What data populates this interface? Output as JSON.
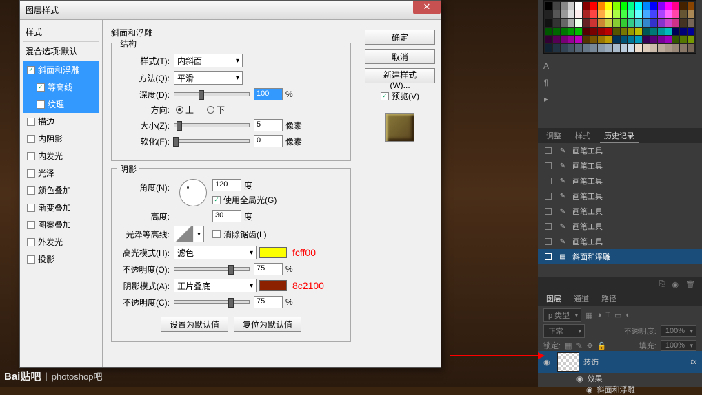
{
  "dialog": {
    "title": "图层样式",
    "styles_header": "样式",
    "blend_options": "混合选项:默认",
    "items": [
      {
        "label": "斜面和浮雕",
        "checked": true,
        "selected": true
      },
      {
        "label": "等高线",
        "checked": true,
        "sub": true,
        "selected": true
      },
      {
        "label": "纹理",
        "checked": false,
        "sub": true,
        "selected": true
      },
      {
        "label": "描边",
        "checked": false
      },
      {
        "label": "内阴影",
        "checked": false
      },
      {
        "label": "内发光",
        "checked": false
      },
      {
        "label": "光泽",
        "checked": false
      },
      {
        "label": "颜色叠加",
        "checked": false
      },
      {
        "label": "渐变叠加",
        "checked": false
      },
      {
        "label": "图案叠加",
        "checked": false
      },
      {
        "label": "外发光",
        "checked": false
      },
      {
        "label": "投影",
        "checked": false
      }
    ],
    "section_title": "斜面和浮雕",
    "structure": {
      "legend": "结构",
      "style_lbl": "样式(T):",
      "style_val": "内斜面",
      "technique_lbl": "方法(Q):",
      "technique_val": "平滑",
      "depth_lbl": "深度(D):",
      "depth_val": "100",
      "depth_unit": "%",
      "direction_lbl": "方向:",
      "up": "上",
      "down": "下",
      "size_lbl": "大小(Z):",
      "size_val": "5",
      "size_unit": "像素",
      "soften_lbl": "软化(F):",
      "soften_val": "0",
      "soften_unit": "像素"
    },
    "shadow": {
      "legend": "阴影",
      "angle_lbl": "角度(N):",
      "angle_val": "120",
      "angle_unit": "度",
      "global_light": "使用全局光(G)",
      "altitude_lbl": "高度:",
      "altitude_val": "30",
      "altitude_unit": "度",
      "gloss_contour_lbl": "光泽等高线:",
      "antialias": "消除锯齿(L)",
      "highlight_mode_lbl": "高光模式(H):",
      "highlight_mode_val": "滤色",
      "highlight_color": "#fcff00",
      "highlight_hex": "fcff00",
      "highlight_opacity_lbl": "不透明度(O):",
      "highlight_opacity_val": "75",
      "opacity_unit": "%",
      "shadow_mode_lbl": "阴影模式(A):",
      "shadow_mode_val": "正片叠底",
      "shadow_color": "#8c2100",
      "shadow_hex": "8c2100",
      "shadow_opacity_lbl": "不透明度(C):",
      "shadow_opacity_val": "75"
    },
    "make_default": "设置为默认值",
    "reset_default": "复位为默认值",
    "buttons": {
      "ok": "确定",
      "cancel": "取消",
      "new_style": "新建样式(W)...",
      "preview": "预览(V)"
    }
  },
  "panels": {
    "tabs": {
      "adjust": "调整",
      "style": "样式",
      "history": "历史记录"
    },
    "history": [
      "画笔工具",
      "画笔工具",
      "画笔工具",
      "画笔工具",
      "画笔工具",
      "画笔工具",
      "画笔工具"
    ],
    "history_selected": "斜面和浮雕",
    "layer_tabs": {
      "layers": "图层",
      "channels": "通道",
      "paths": "路径"
    },
    "kind": "p 类型",
    "blend_mode": "正常",
    "opacity_lbl": "不透明度:",
    "opacity_val": "100%",
    "lock_lbl": "锁定:",
    "fill_lbl": "填充:",
    "fill_val": "100%",
    "layer_name": "装饰",
    "fx": "fx",
    "effects": "效果",
    "effect_item": "斜面和浮雕"
  },
  "footer": {
    "logo": "Bai贴吧",
    "sep": "|",
    "text": "photoshop吧"
  },
  "swatch_colors": [
    "#000",
    "#444",
    "#888",
    "#ccc",
    "#fff",
    "#800",
    "#f00",
    "#f80",
    "#ff0",
    "#8f0",
    "#0f0",
    "#0f8",
    "#0ff",
    "#08f",
    "#00f",
    "#80f",
    "#f0f",
    "#f08",
    "#420",
    "#840",
    "#222",
    "#555",
    "#999",
    "#ddd",
    "#fee",
    "#a22",
    "#f44",
    "#fa4",
    "#ff6",
    "#af4",
    "#4f4",
    "#4fa",
    "#6ff",
    "#4af",
    "#44f",
    "#a4f",
    "#f6f",
    "#f4a",
    "#653",
    "#a85",
    "#111",
    "#333",
    "#666",
    "#aaa",
    "#efe",
    "#622",
    "#c33",
    "#c83",
    "#cc4",
    "#8c3",
    "#3c3",
    "#3c8",
    "#4cc",
    "#38c",
    "#33c",
    "#83c",
    "#c4c",
    "#c38",
    "#432",
    "#765",
    "#050",
    "#060",
    "#070",
    "#090",
    "#0b0",
    "#500",
    "#700",
    "#900",
    "#b00",
    "#550",
    "#770",
    "#990",
    "#bb0",
    "#055",
    "#077",
    "#099",
    "#0bb",
    "#005",
    "#007",
    "#009",
    "#303",
    "#505",
    "#707",
    "#909",
    "#b0b",
    "#530",
    "#750",
    "#970",
    "#b90",
    "#035",
    "#057",
    "#079",
    "#09b",
    "#305",
    "#507",
    "#709",
    "#90b",
    "#350",
    "#570",
    "#790",
    "#123",
    "#234",
    "#345",
    "#456",
    "#567",
    "#678",
    "#789",
    "#89a",
    "#9ab",
    "#abc",
    "#bcd",
    "#cde",
    "#edc",
    "#dcb",
    "#cba",
    "#ba9",
    "#a98",
    "#987",
    "#876",
    "#765"
  ]
}
